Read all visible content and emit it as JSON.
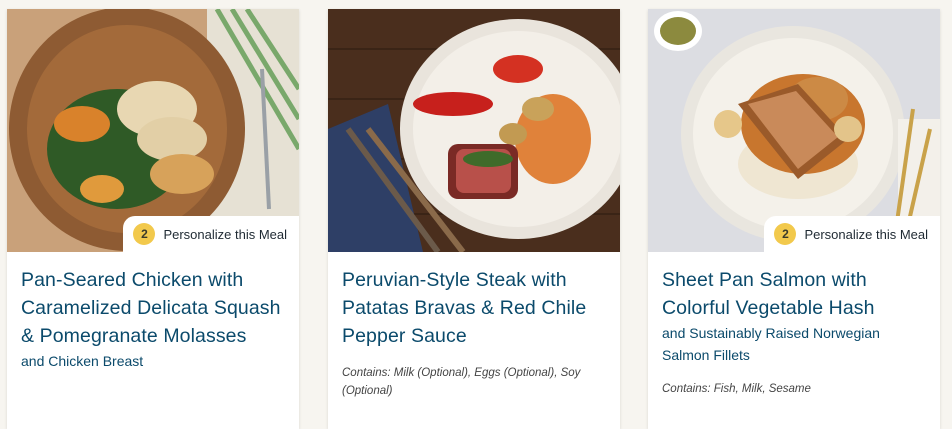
{
  "cards": [
    {
      "badge_count": "2",
      "badge_label": "Personalize this Meal",
      "title": "Pan-Seared Chicken with Caramelized Delicata Squash & Pomegranate Molasses",
      "subtitle": "and Chicken Breast",
      "contains": ""
    },
    {
      "badge_count": "",
      "badge_label": "",
      "title": "Peruvian-Style Steak with Patatas Bravas & Red Chile Pepper Sauce",
      "subtitle": "",
      "contains": "Contains: Milk (Optional), Eggs (Optional), Soy (Optional)"
    },
    {
      "badge_count": "2",
      "badge_label": "Personalize this Meal",
      "title": "Sheet Pan Salmon with Colorful Vegetable Hash",
      "subtitle": "and Sustainably Raised Norwegian Salmon Fillets",
      "contains": "Contains: Fish, Milk, Sesame"
    }
  ],
  "colors": {
    "title": "#0b4a6b",
    "badge": "#f2c94c"
  }
}
